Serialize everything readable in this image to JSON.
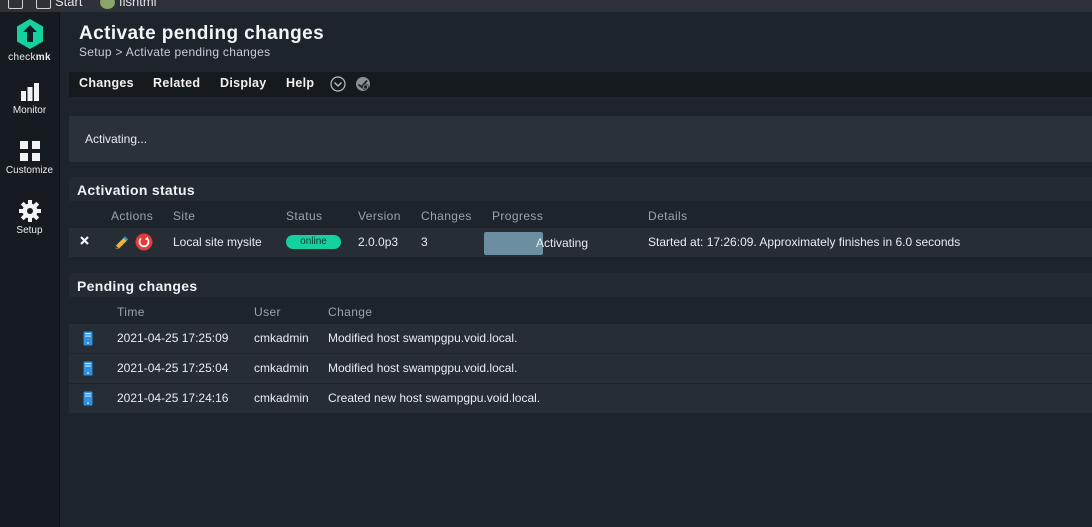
{
  "os_strip": {
    "items": [
      "Start",
      "fishtml"
    ]
  },
  "sidebar": {
    "brand_prefix": "check",
    "brand_suffix": "mk",
    "nav": [
      {
        "label": "Monitor",
        "icon": "bar-chart-icon"
      },
      {
        "label": "Customize",
        "icon": "grid-icon"
      },
      {
        "label": "Setup",
        "icon": "gear-icon"
      }
    ]
  },
  "header": {
    "title": "Activate pending changes",
    "breadcrumb": "Setup > Activate pending changes"
  },
  "menubar": {
    "items": [
      "Changes",
      "Related",
      "Display",
      "Help"
    ]
  },
  "info": {
    "text": "Activating..."
  },
  "activation": {
    "title": "Activation status",
    "columns": [
      "Actions",
      "Site",
      "Status",
      "Version",
      "Changes",
      "Progress",
      "Details"
    ],
    "row": {
      "site": "Local site mysite",
      "status": "online",
      "version": "2.0.0p3",
      "changes": "3",
      "progress_label": "Activating",
      "details": "Started at: 17:26:09. Approximately finishes in 6.0 seconds"
    }
  },
  "pending": {
    "title": "Pending changes",
    "columns": [
      "Time",
      "User",
      "Change"
    ],
    "rows": [
      {
        "time": "2021-04-25 17:25:09",
        "user": "cmkadmin",
        "change": "Modified host swampgpu.void.local."
      },
      {
        "time": "2021-04-25 17:25:04",
        "user": "cmkadmin",
        "change": "Modified host swampgpu.void.local."
      },
      {
        "time": "2021-04-25 17:24:16",
        "user": "cmkadmin",
        "change": "Created new host swampgpu.void.local."
      }
    ]
  },
  "colors": {
    "accent_green": "#15d1a0",
    "progress_fill": "#6b8fa0",
    "host_icon_blue": "#2f8fe0",
    "stop_red": "#e23b3b"
  }
}
